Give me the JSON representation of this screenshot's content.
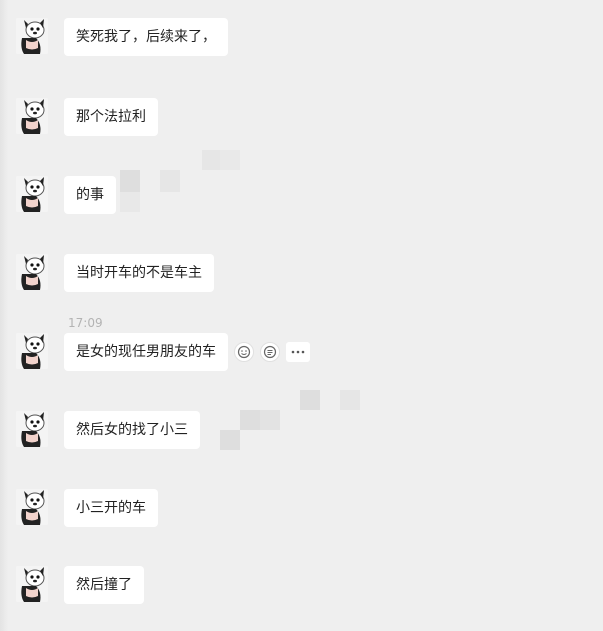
{
  "chat": {
    "timestamp": "17:09",
    "messages": [
      {
        "text": "笑死我了，后续来了，"
      },
      {
        "text": "那个法拉利"
      },
      {
        "text": "的事"
      },
      {
        "text": "当时开车的不是车主"
      },
      {
        "text": "是女的现任男朋友的车"
      },
      {
        "text": "然后女的找了小三"
      },
      {
        "text": "小三开的车"
      },
      {
        "text": "然后撞了"
      }
    ],
    "hover_actions": [
      "emoji-icon",
      "quote-icon",
      "more-icon"
    ]
  },
  "colors": {
    "background": "#efefef",
    "bubble": "#ffffff",
    "text": "#222222",
    "timestamp": "#b3b3b3"
  }
}
